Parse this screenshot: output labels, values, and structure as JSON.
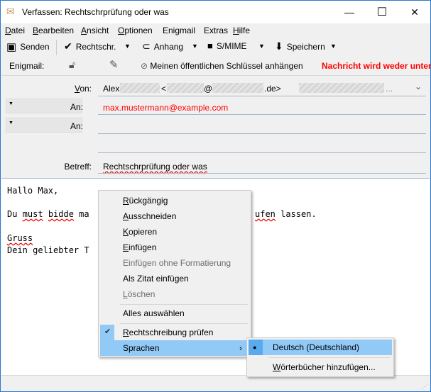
{
  "window": {
    "title": "Verfassen: Rechtschrprüfung oder was",
    "minimize": "—",
    "maximize": "☐",
    "close": "✕"
  },
  "menubar": [
    "Datei",
    "Bearbeiten",
    "Ansicht",
    "Optionen",
    "Enigmail",
    "Extras",
    "Hilfe"
  ],
  "toolbar": {
    "send": "Senden",
    "spell": "Rechtschr.",
    "attach": "Anhang",
    "smime": "S/MIME",
    "save": "Speichern"
  },
  "enigmail": {
    "label": "Enigmail:",
    "attach_key": "Meinen öffentlichen Schlüssel anhängen",
    "status": "Nachricht wird weder unter"
  },
  "header": {
    "from_label": "Von:",
    "from_name": "Alex",
    "from_lt": "<",
    "from_at": "@",
    "from_domain": ".de>",
    "from_ellipsis": "...",
    "to_label": "An:",
    "to_value": "max.mustermann@example.com",
    "to2_label": "An:",
    "subject_label": "Betreff:",
    "subject": "Rechtschrprüfung oder was"
  },
  "body": {
    "line1": "Hallo Max,",
    "line2a": "Du ",
    "line2b": "must",
    "line2c": " ",
    "line2d": "bidde",
    "line2e": " ma",
    "line2f": "ufen",
    "line2g": " lassen.",
    "line3": "Gruss",
    "line4": "Dein geliebter T"
  },
  "context_menu": {
    "items": [
      "Rückgängig",
      "Ausschneiden",
      "Kopieren",
      "Einfügen",
      "Einfügen ohne Formatierung",
      "Als Zitat einfügen",
      "Löschen",
      "Alles auswählen",
      "Rechtschreibung prüfen",
      "Sprachen"
    ],
    "arrow": "›",
    "check": "✔"
  },
  "submenu": {
    "items": [
      "Deutsch (Deutschland)",
      "Wörterbücher hinzufügen..."
    ],
    "bullet": "●"
  },
  "colors": {
    "highlight": "#91c9f7",
    "error": "#ff0000"
  }
}
